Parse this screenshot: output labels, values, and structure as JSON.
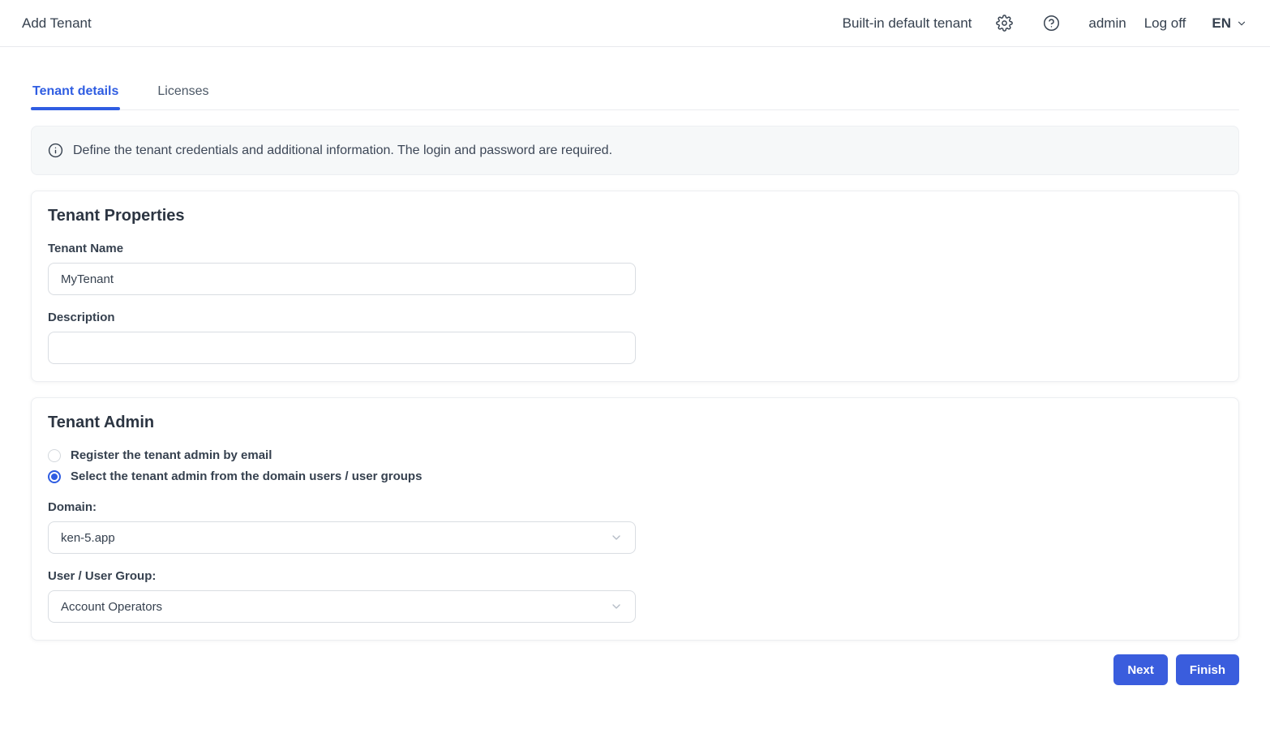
{
  "header": {
    "title": "Add Tenant",
    "tenant_context": "Built-in default tenant",
    "user_name": "admin",
    "logoff_label": "Log off",
    "language": "EN"
  },
  "tabs": [
    {
      "label": "Tenant details",
      "active": true
    },
    {
      "label": "Licenses",
      "active": false
    }
  ],
  "info_banner": {
    "text": "Define the tenant credentials and additional information. The login and password are required."
  },
  "tenant_properties": {
    "title": "Tenant Properties",
    "tenant_name_label": "Tenant Name",
    "tenant_name_value": "MyTenant",
    "description_label": "Description",
    "description_value": ""
  },
  "tenant_admin": {
    "title": "Tenant Admin",
    "options": [
      {
        "label": "Register the tenant admin by email",
        "selected": false
      },
      {
        "label": "Select the tenant admin from the domain users / user groups",
        "selected": true
      }
    ],
    "domain_label": "Domain:",
    "domain_value": "ken-5.app",
    "user_group_label": "User / User Group:",
    "user_group_value": "Account Operators"
  },
  "actions": {
    "next_label": "Next",
    "finish_label": "Finish"
  },
  "colors": {
    "accent": "#3a5ddd",
    "heading": "#2c3542",
    "text": "#36414f"
  }
}
